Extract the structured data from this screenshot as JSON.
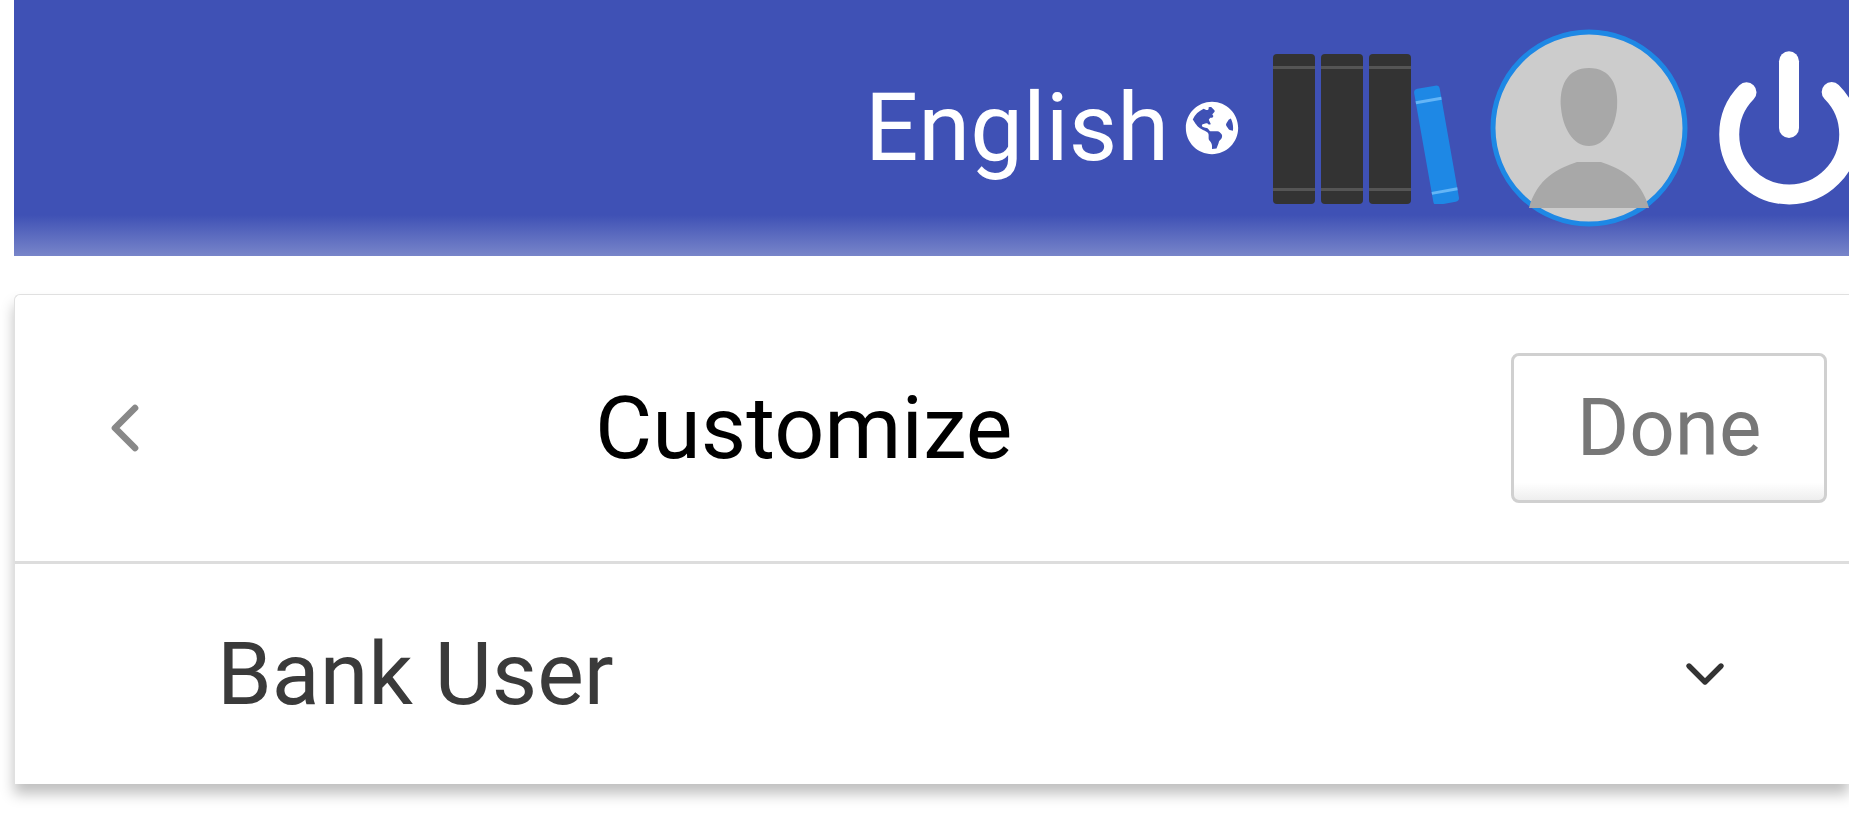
{
  "header": {
    "language": "English"
  },
  "panel": {
    "title": "Customize",
    "done_button": "Done",
    "dropdown": {
      "value": "Bank User"
    }
  }
}
